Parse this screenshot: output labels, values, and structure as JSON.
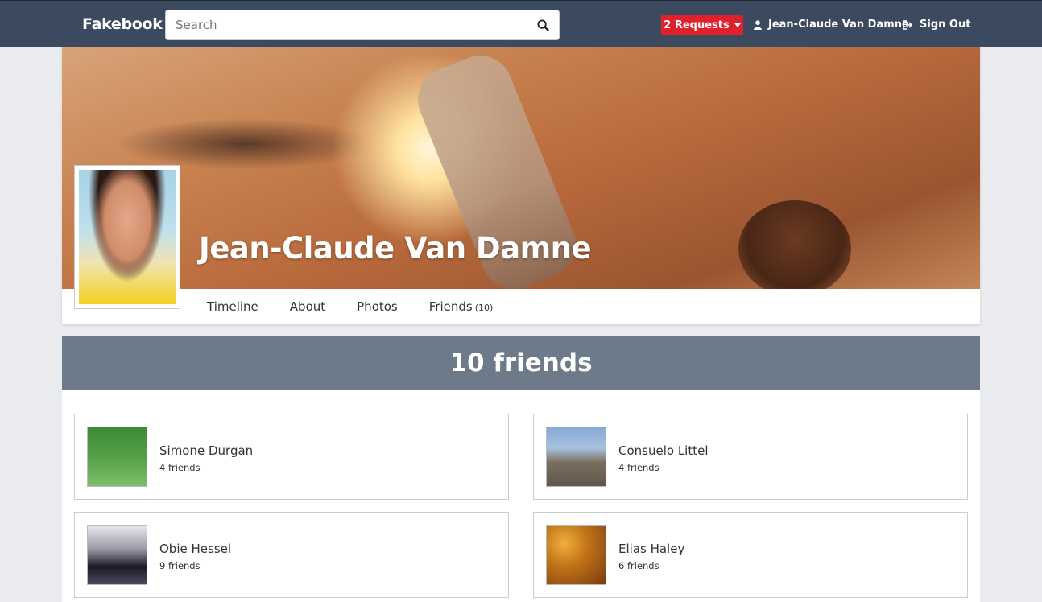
{
  "navbar": {
    "brand": "Fakebook",
    "search_placeholder": "Search",
    "requests_label": "2 Requests",
    "user_name": "Jean-Claude Van Damne",
    "signout_label": "Sign Out"
  },
  "profile": {
    "name": "Jean-Claude Van Damne",
    "tabs": [
      {
        "label": "Timeline"
      },
      {
        "label": "About"
      },
      {
        "label": "Photos"
      },
      {
        "label": "Friends",
        "count": "(10)"
      }
    ]
  },
  "friends": {
    "heading": "10 friends",
    "list": [
      {
        "name": "Simone Durgan",
        "count": "4 friends"
      },
      {
        "name": "Consuelo Littel",
        "count": "4 friends"
      },
      {
        "name": "Obie Hessel",
        "count": "9 friends"
      },
      {
        "name": "Elias Haley",
        "count": "6 friends"
      }
    ]
  },
  "colors": {
    "navbar_bg": "#3b4a5e",
    "requests_bg": "#e0202b",
    "friends_header_bg": "#6c7a89"
  },
  "icons": [
    "search-icon",
    "user-icon",
    "sign-out-icon",
    "caret-down-icon"
  ]
}
